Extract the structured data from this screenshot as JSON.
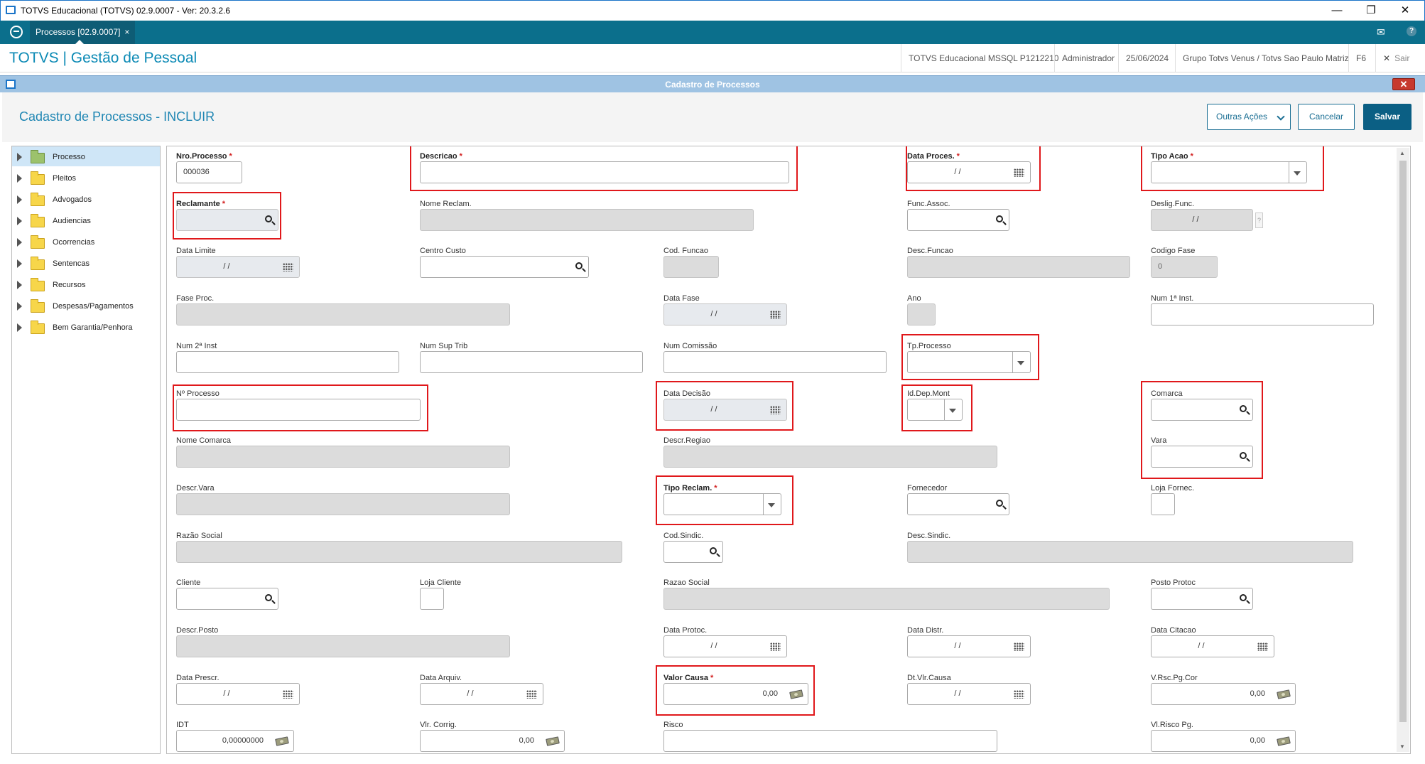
{
  "window": {
    "title": "TOTVS Educacional (TOTVS) 02.9.0007 - Ver: 20.3.2.6",
    "minimize": "—",
    "maximize": "❐",
    "close": "✕"
  },
  "tabbar": {
    "tab_label": "Processos [02.9.0007]",
    "tab_close": "×",
    "mail_icon": "✉",
    "help_icon": "?"
  },
  "header": {
    "brand": "TOTVS | Gestão de Pessoal",
    "environment": "TOTVS Educacional MSSQL P1212210",
    "user": "Administrador",
    "date": "25/06/2024",
    "company": "Grupo Totvs Venus / Totvs Sao Paulo Matriz",
    "shortcut": "F6",
    "exit": "Sair",
    "exit_icon": "✕"
  },
  "dialog": {
    "title": "Cadastro de Processos",
    "close": "✕",
    "form_title": "Cadastro de Processos - INCLUIR",
    "buttons": {
      "more_actions": "Outras Ações",
      "cancel": "Cancelar",
      "save": "Salvar"
    }
  },
  "tree": [
    {
      "label": "Processo",
      "selected": true
    },
    {
      "label": "Pleitos"
    },
    {
      "label": "Advogados"
    },
    {
      "label": "Audiencias"
    },
    {
      "label": "Ocorrencias"
    },
    {
      "label": "Sentencas"
    },
    {
      "label": "Recursos"
    },
    {
      "label": "Despesas/Pagamentos"
    },
    {
      "label": "Bem Garantia/Penhora"
    }
  ],
  "form": {
    "nro_processo": {
      "label": "Nro.Processo",
      "value": "000036",
      "required": "*"
    },
    "descricao": {
      "label": "Descricao",
      "value": "",
      "required": "*"
    },
    "data_proces": {
      "label": "Data Proces.",
      "value": " / /",
      "required": "*"
    },
    "tipo_acao": {
      "label": "Tipo Acao",
      "value": "",
      "required": "*"
    },
    "reclamante": {
      "label": "Reclamante",
      "value": "",
      "required": "*"
    },
    "nome_reclam": {
      "label": "Nome Reclam.",
      "value": ""
    },
    "func_assoc": {
      "label": "Func.Assoc.",
      "value": ""
    },
    "deslig_func": {
      "label": "Deslig.Func.",
      "value": " / /",
      "help": "?"
    },
    "data_limite": {
      "label": "Data Limite",
      "value": " / /"
    },
    "centro_custo": {
      "label": "Centro Custo",
      "value": ""
    },
    "cod_funcao": {
      "label": "Cod. Funcao",
      "value": ""
    },
    "desc_funcao": {
      "label": "Desc.Funcao",
      "value": ""
    },
    "codigo_fase": {
      "label": "Codigo Fase",
      "value": "0"
    },
    "fase_proc": {
      "label": "Fase Proc.",
      "value": ""
    },
    "data_fase": {
      "label": "Data Fase",
      "value": " / /"
    },
    "ano": {
      "label": "Ano",
      "value": ""
    },
    "num_1_inst": {
      "label": "Num 1ª Inst.",
      "value": ""
    },
    "num_2_inst": {
      "label": "Num 2ª Inst",
      "value": ""
    },
    "num_sup_trib": {
      "label": "Num Sup Trib",
      "value": ""
    },
    "num_comissao": {
      "label": "Num Comissão",
      "value": ""
    },
    "tp_processo": {
      "label": "Tp.Processo",
      "value": ""
    },
    "n_processo": {
      "label": "Nº Processo",
      "value": ""
    },
    "data_decisao": {
      "label": "Data Decisão",
      "value": " / /"
    },
    "id_dep_mont": {
      "label": "Id.Dep.Mont",
      "value": ""
    },
    "comarca": {
      "label": "Comarca",
      "value": ""
    },
    "nome_comarca": {
      "label": "Nome Comarca",
      "value": ""
    },
    "descr_regiao": {
      "label": "Descr.Regiao",
      "value": ""
    },
    "vara": {
      "label": "Vara",
      "value": ""
    },
    "descr_vara": {
      "label": "Descr.Vara",
      "value": ""
    },
    "tipo_reclam": {
      "label": "Tipo Reclam.",
      "value": "",
      "required": "*"
    },
    "fornecedor": {
      "label": "Fornecedor",
      "value": ""
    },
    "loja_fornec": {
      "label": "Loja Fornec.",
      "value": ""
    },
    "razao_social_1": {
      "label": "Razão Social",
      "value": ""
    },
    "cod_sindic": {
      "label": "Cod.Sindic.",
      "value": ""
    },
    "desc_sindic": {
      "label": "Desc.Sindic.",
      "value": ""
    },
    "cliente": {
      "label": "Cliente",
      "value": ""
    },
    "loja_cliente": {
      "label": "Loja Cliente",
      "value": ""
    },
    "razao_social_2": {
      "label": "Razao Social",
      "value": ""
    },
    "posto_protoc": {
      "label": "Posto Protoc",
      "value": ""
    },
    "descr_posto": {
      "label": "Descr.Posto",
      "value": ""
    },
    "data_protoc": {
      "label": "Data Protoc.",
      "value": " / /"
    },
    "data_distr": {
      "label": "Data Distr.",
      "value": " / /"
    },
    "data_citacao": {
      "label": "Data Citacao",
      "value": " / /"
    },
    "data_prescr": {
      "label": "Data Prescr.",
      "value": " / /"
    },
    "data_arquiv": {
      "label": "Data Arquiv.",
      "value": " / /"
    },
    "valor_causa": {
      "label": "Valor Causa",
      "value": "0,00",
      "required": "*"
    },
    "dt_vlr_causa": {
      "label": "Dt.Vlr.Causa",
      "value": " / /"
    },
    "v_rsc_pg_cor": {
      "label": "V.Rsc.Pg.Cor",
      "value": "0,00"
    },
    "idt": {
      "label": "IDT",
      "value": "0,00000000"
    },
    "vlr_corrig": {
      "label": "Vlr. Corrig.",
      "value": "0,00"
    },
    "risco": {
      "label": "Risco",
      "value": ""
    },
    "vl_risco_pg": {
      "label": "Vl.Risco Pg.",
      "value": "0,00"
    }
  },
  "scroll": {
    "up": "▲",
    "down": "▼"
  }
}
